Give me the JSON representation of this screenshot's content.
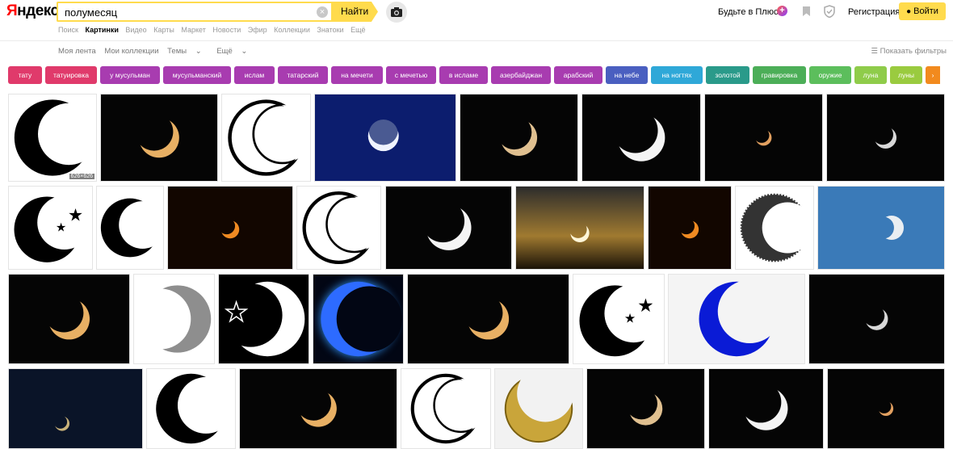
{
  "header": {
    "logo_first": "Я",
    "logo_rest": "ндекс",
    "query": "полумесяц",
    "search_button": "Найти",
    "plus_link": "Будьте в Плюсе",
    "register": "Регистрация",
    "login": "Войти"
  },
  "service_nav": [
    "Поиск",
    "Картинки",
    "Видео",
    "Карты",
    "Маркет",
    "Новости",
    "Эфир",
    "Коллекции",
    "Знатоки",
    "Ещё"
  ],
  "service_nav_active": 1,
  "sub_nav": {
    "my_feed": "Моя лента",
    "my_collections": "Мои коллекции",
    "themes": "Темы",
    "more": "Ещё"
  },
  "filters_link": "Показать фильтры",
  "tags": [
    {
      "label": "тату",
      "color": "#e03a6b"
    },
    {
      "label": "татуировка",
      "color": "#e03a6b"
    },
    {
      "label": "у мусульман",
      "color": "#a83cb0"
    },
    {
      "label": "мусульманский",
      "color": "#a83cb0"
    },
    {
      "label": "ислам",
      "color": "#a83cb0"
    },
    {
      "label": "татарский",
      "color": "#a83cb0"
    },
    {
      "label": "на мечети",
      "color": "#a83cb0"
    },
    {
      "label": "с мечетью",
      "color": "#a83cb0"
    },
    {
      "label": "в исламе",
      "color": "#a83cb0"
    },
    {
      "label": "азербайджан",
      "color": "#a83cb0"
    },
    {
      "label": "арабский",
      "color": "#a83cb0"
    },
    {
      "label": "на небе",
      "color": "#4a5fc0"
    },
    {
      "label": "на ногтях",
      "color": "#2fa8d8"
    },
    {
      "label": "золотой",
      "color": "#2a9a8a"
    },
    {
      "label": "гравировка",
      "color": "#4cae58"
    },
    {
      "label": "оружие",
      "color": "#5cbe5c"
    },
    {
      "label": "луна",
      "color": "#8fcc4a"
    },
    {
      "label": "луны",
      "color": "#9acb3f"
    }
  ],
  "first_thumb_size": "626×626",
  "icons": {
    "clear": "clear-icon",
    "camera": "camera-icon",
    "bookmark": "bookmark-icon",
    "shield": "shield-icon",
    "plus": "plus-icon",
    "person": "person-icon",
    "filter": "filter-icon",
    "tag_more": "chevron-right-icon"
  },
  "colors": {
    "accent_yellow": "#ffdb4d",
    "logo_red": "#ff0000"
  }
}
